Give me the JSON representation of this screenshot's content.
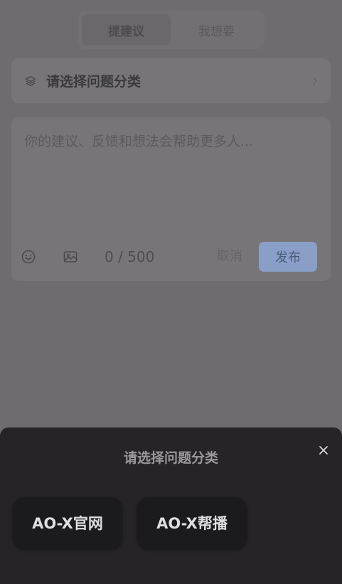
{
  "tabs": [
    {
      "label": "提建议",
      "active": true
    },
    {
      "label": "我想要",
      "active": false
    }
  ],
  "category": {
    "label": "请选择问题分类",
    "icon": "layers-icon"
  },
  "composer": {
    "placeholder": "你的建议、反馈和想法会帮助更多人...",
    "value": "",
    "counter": "0 / 500",
    "cancel_label": "取消",
    "publish_label": "发布"
  },
  "sheet": {
    "title": "请选择问题分类",
    "options": [
      {
        "label": "AO-X官网"
      },
      {
        "label": "AO-X帮播"
      }
    ]
  },
  "colors": {
    "overlay_background": "#6e6c6f",
    "sheet_background": "#262428",
    "publish_button": "#8a9fc7"
  }
}
